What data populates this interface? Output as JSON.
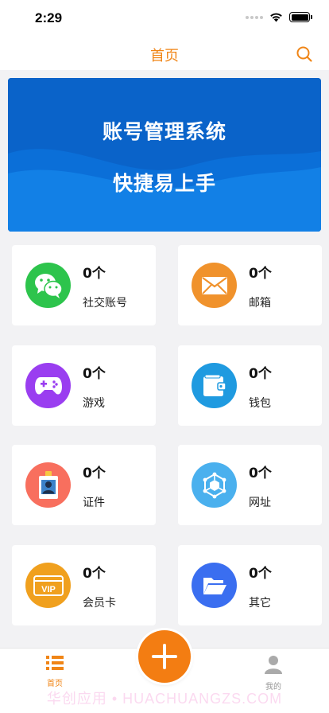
{
  "status_bar": {
    "time": "2:29"
  },
  "header": {
    "title": "首页"
  },
  "banner": {
    "line1": "账号管理系统",
    "line2": "快捷易上手"
  },
  "cards": [
    {
      "count": "0个",
      "label": "社交账号",
      "icon": "wechat-icon",
      "color": "#2dc44c"
    },
    {
      "count": "0个",
      "label": "邮箱",
      "icon": "mail-icon",
      "color": "#f0922c"
    },
    {
      "count": "0个",
      "label": "游戏",
      "icon": "gamepad-icon",
      "color": "#9a3ef0"
    },
    {
      "count": "0个",
      "label": "钱包",
      "icon": "wallet-icon",
      "color": "#1f9ae0"
    },
    {
      "count": "0个",
      "label": "证件",
      "icon": "id-badge-icon",
      "color": "#f86f5e"
    },
    {
      "count": "0个",
      "label": "网址",
      "icon": "network-icon",
      "color": "#4ab0ee"
    },
    {
      "count": "0个",
      "label": "会员卡",
      "icon": "vip-card-icon",
      "color": "#f0a01e"
    },
    {
      "count": "0个",
      "label": "其它",
      "icon": "folder-icon",
      "color": "#3a6ef0"
    }
  ],
  "tab_bar": {
    "home_label": "首页",
    "me_label": "我的"
  },
  "watermark": "华创应用 • HUACHUANGZS.COM",
  "colors": {
    "accent": "#f08516",
    "banner": "#0a6bd3"
  }
}
